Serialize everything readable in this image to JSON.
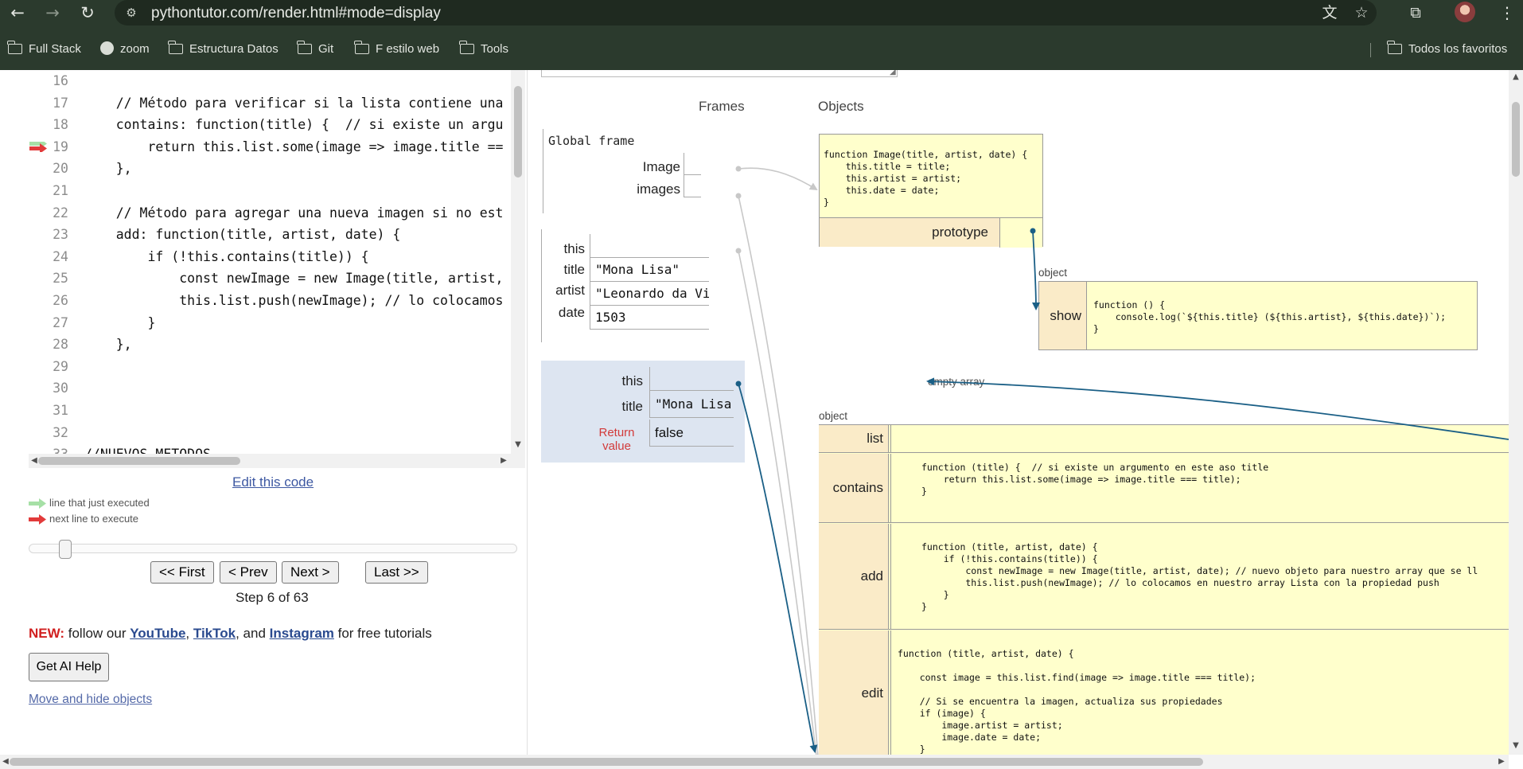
{
  "browser": {
    "url": "pythontutor.com/render.html#mode=display",
    "icons": {
      "back": "back-arrow-icon",
      "forward": "forward-arrow-icon",
      "reload": "reload-icon",
      "site_info": "site-info-icon",
      "translate": "translate-icon",
      "bookmark_star": "star-icon",
      "extensions": "extensions-icon"
    },
    "bookmarks": [
      "Full Stack",
      "zoom",
      "Estructura Datos",
      "Git",
      "F estilo web",
      "Tools"
    ],
    "all_bookmarks_label": "Todos los favoritos"
  },
  "code": {
    "lines": [
      {
        "num": "16",
        "text": ""
      },
      {
        "num": "17",
        "text": "    // Método para verificar si la lista contiene una"
      },
      {
        "num": "18",
        "text": "    contains: function(title) {  // si existe un argu"
      },
      {
        "num": "19",
        "text": "        return this.list.some(image => image.title =="
      },
      {
        "num": "20",
        "text": "    },"
      },
      {
        "num": "21",
        "text": ""
      },
      {
        "num": "22",
        "text": "    // Método para agregar una nueva imagen si no est"
      },
      {
        "num": "23",
        "text": "    add: function(title, artist, date) {"
      },
      {
        "num": "24",
        "text": "        if (!this.contains(title)) {"
      },
      {
        "num": "25",
        "text": "            const newImage = new Image(title, artist,"
      },
      {
        "num": "26",
        "text": "            this.list.push(newImage); // lo colocamos"
      },
      {
        "num": "27",
        "text": "        }"
      },
      {
        "num": "28",
        "text": "    },"
      },
      {
        "num": "29",
        "text": ""
      },
      {
        "num": "30",
        "text": ""
      },
      {
        "num": "31",
        "text": ""
      },
      {
        "num": "32",
        "text": ""
      },
      {
        "num": "33",
        "text": "//NUEVOS METODOS"
      }
    ],
    "current_line": "19"
  },
  "controls": {
    "edit_link": "Edit this code",
    "legend_executed": "line that just executed",
    "legend_next": "next line to execute",
    "first": "<< First",
    "prev": "< Prev",
    "next": "Next >",
    "last": "Last >>",
    "step": "Step 6 of 63",
    "step_current": 6,
    "step_total": 63
  },
  "promo": {
    "new": "NEW:",
    "text1": " follow our ",
    "youtube": "YouTube",
    "sep1": ", ",
    "tiktok": "TikTok",
    "sep2": ", and ",
    "instagram": "Instagram",
    "text2": " for free tutorials"
  },
  "ai_help": "Get AI Help",
  "move_hide": "Move and hide objects",
  "viz": {
    "frames_header": "Frames",
    "objects_header": "Objects",
    "global_frame": {
      "title": "Global frame",
      "vars": [
        "Image",
        "images"
      ]
    },
    "frame1": {
      "vars": [
        {
          "name": "this",
          "value": ""
        },
        {
          "name": "title",
          "value": "\"Mona Lisa\""
        },
        {
          "name": "artist",
          "value": "\"Leonardo da Vinci\""
        },
        {
          "name": "date",
          "value": "1503"
        }
      ]
    },
    "frame2": {
      "vars": [
        {
          "name": "this",
          "value": ""
        },
        {
          "name": "title",
          "value": "\"Mona Lisa\""
        }
      ],
      "return_label": "Return\nvalue",
      "return_value": "false"
    },
    "image_func": "function Image(title, artist, date) {\n    this.title = title;\n    this.artist = artist;\n    this.date = date;\n}",
    "prototype_label": "prototype",
    "proto_obj_label": "object",
    "show_key": "show",
    "show_func": "function () {\n    console.log(`${this.title} (${this.artist}, ${this.date})`);\n}",
    "empty_array": "empty array",
    "images_obj_label": "object",
    "rows": [
      {
        "key": "list",
        "code": ""
      },
      {
        "key": "contains",
        "code": "function (title) {  // si existe un argumento en este aso title\n    return this.list.some(image => image.title === title);\n}"
      },
      {
        "key": "add",
        "code": "function (title, artist, date) {\n    if (!this.contains(title)) {\n        const newImage = new Image(title, artist, date); // nuevo objeto para nuestro array que se ll\n        this.list.push(newImage); // lo colocamos en nuestro array Lista con la propiedad push\n    }\n}"
      },
      {
        "key": "edit",
        "code": "function (title, artist, date) {\n\n    const image = this.list.find(image => image.title === title);\n\n    // Si se encuentra la imagen, actualiza sus propiedades\n    if (image) {\n        image.artist = artist;\n        image.date = date;\n    }"
      }
    ]
  },
  "colors": {
    "pointer": "#1a5f86",
    "pointer_light": "#c8c8c8",
    "object_bg": "#ffffcc",
    "key_bg": "#faebc8",
    "active_frame": "#dde5f1",
    "next_arrow": "#e23b3b",
    "executed_arrow": "#a6e0a6"
  }
}
